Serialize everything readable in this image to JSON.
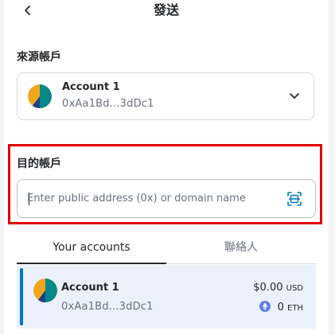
{
  "header": {
    "title": "發送",
    "back_icon": "chevron-left-icon"
  },
  "from": {
    "label": "來源帳戶",
    "account_name": "Account 1",
    "account_address": "0xAa1Bd...3dDc1",
    "expand_icon": "chevron-down-icon"
  },
  "to": {
    "label": "目的帳戶",
    "placeholder": "Enter public address (0x) or domain name",
    "scan_icon": "qr-scan-icon"
  },
  "tabs": {
    "accounts": "Your accounts",
    "contacts": "聯絡人"
  },
  "accounts": [
    {
      "name": "Account 1",
      "address": "0xAa1Bd...3dDc1",
      "fiat_amount": "$0.00",
      "fiat_unit": "USD",
      "eth_amount": "0",
      "eth_unit": "ETH"
    }
  ],
  "colors": {
    "highlight": "#e00000",
    "accent": "#0376c9",
    "row_bg": "#eaf1fa"
  }
}
